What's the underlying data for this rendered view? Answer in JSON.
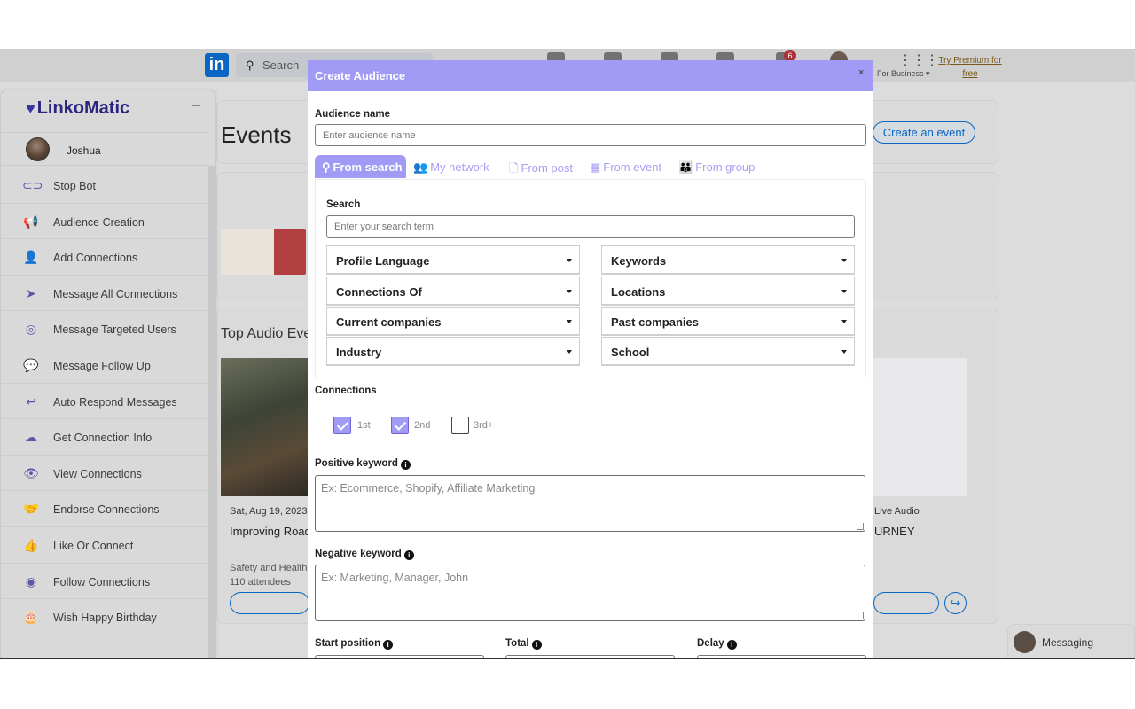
{
  "linkedin": {
    "logo": "in",
    "search_placeholder": "Search",
    "notification_count": "6",
    "for_business": "For Business",
    "premium_line1": "Try Premium for",
    "premium_line2": "free"
  },
  "background": {
    "events_title": "Events",
    "create_event_button": "Create an event",
    "top_audio_title": "Top Audio Eve",
    "card1_date": "Sat, Aug 19, 2023,",
    "card1_title": "Improving Road",
    "card1_org": "Safety and Health",
    "card1_attendees": "110 attendees",
    "card2_type": "Live Audio",
    "card2_title": "URNEY"
  },
  "sidebar": {
    "brand": "LinkoMatic",
    "minimize": "–",
    "user_name": "Joshua",
    "items": [
      {
        "label": "Stop Bot",
        "icon": "toggle-icon",
        "glyph": "⊂⊃"
      },
      {
        "label": "Audience Creation",
        "icon": "megaphone-icon",
        "glyph": "📢"
      },
      {
        "label": "Add Connections",
        "icon": "user-plus-icon",
        "glyph": "👤"
      },
      {
        "label": "Message All Connections",
        "icon": "paper-plane-icon",
        "glyph": "➤"
      },
      {
        "label": "Message Targeted Users",
        "icon": "target-icon",
        "glyph": "◎"
      },
      {
        "label": "Message Follow Up",
        "icon": "chat-bubbles-icon",
        "glyph": "💬"
      },
      {
        "label": "Auto Respond Messages",
        "icon": "reply-icon",
        "glyph": "↩"
      },
      {
        "label": "Get Connection Info",
        "icon": "cloud-download-icon",
        "glyph": "☁"
      },
      {
        "label": "View Connections",
        "icon": "eye-icon",
        "glyph": "👁"
      },
      {
        "label": "Endorse Connections",
        "icon": "handshake-icon",
        "glyph": "🤝"
      },
      {
        "label": "Like Or Connect",
        "icon": "thumbs-up-icon",
        "glyph": "👍"
      },
      {
        "label": "Follow Connections",
        "icon": "user-circle-icon",
        "glyph": "◉"
      },
      {
        "label": "Wish Happy Birthday",
        "icon": "birthday-cake-icon",
        "glyph": "🎂"
      }
    ]
  },
  "messaging": {
    "label": "Messaging"
  },
  "modal": {
    "title": "Create Audience",
    "close": "×",
    "audience_name_label": "Audience name",
    "audience_name_placeholder": "Enter audience name",
    "tabs": [
      {
        "label": "From search",
        "icon": "search-icon",
        "active": true
      },
      {
        "label": "My network",
        "icon": "users-icon",
        "active": false
      },
      {
        "label": "From post",
        "icon": "document-icon",
        "active": false
      },
      {
        "label": "From event",
        "icon": "calendar-icon",
        "active": false
      },
      {
        "label": "From group",
        "icon": "group-icon",
        "active": false
      }
    ],
    "search_label": "Search",
    "search_placeholder": "Enter your search term",
    "filters": {
      "profile_language": "Profile Language",
      "keywords": "Keywords",
      "connections_of": "Connections Of",
      "locations": "Locations",
      "current_companies": "Current companies",
      "past_companies": "Past companies",
      "industry": "Industry",
      "school": "School"
    },
    "connections_label": "Connections",
    "connections": [
      {
        "label": "1st",
        "checked": true
      },
      {
        "label": "2nd",
        "checked": true
      },
      {
        "label": "3rd+",
        "checked": false
      }
    ],
    "positive_keyword_label": "Positive keyword",
    "positive_keyword_placeholder": "Ex: Ecommerce, Shopify, Affiliate Marketing",
    "negative_keyword_label": "Negative keyword",
    "negative_keyword_placeholder": "Ex: Marketing, Manager, John",
    "start_position_label": "Start position",
    "total_label": "Total",
    "delay_label": "Delay",
    "accent_color": "#a19bf5"
  }
}
